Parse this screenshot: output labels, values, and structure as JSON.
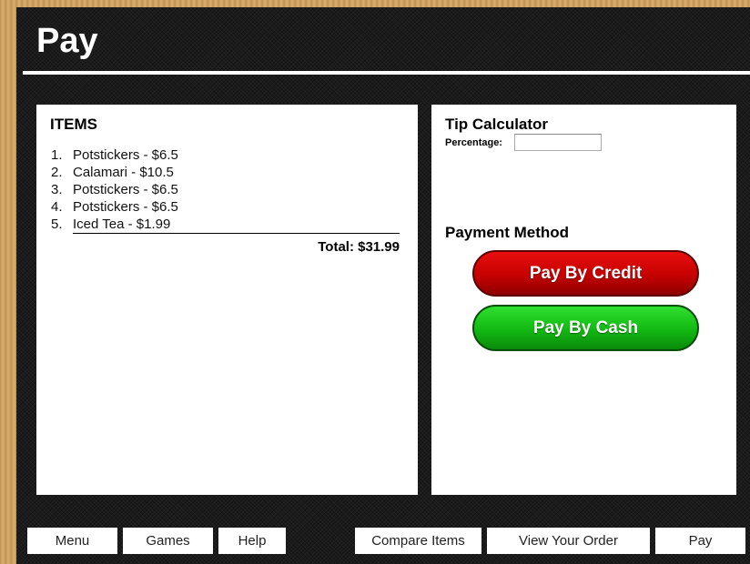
{
  "page": {
    "title": "Pay"
  },
  "items_panel": {
    "heading": "ITEMS",
    "items": [
      {
        "num": "1.",
        "text": "Potstickers - $6.5"
      },
      {
        "num": "2.",
        "text": "Calamari - $10.5"
      },
      {
        "num": "3.",
        "text": "Potstickers - $6.5"
      },
      {
        "num": "4.",
        "text": "Potstickers - $6.5"
      },
      {
        "num": "5.",
        "text": "Iced Tea - $1.99"
      }
    ],
    "total": "Total: $31.99"
  },
  "tip": {
    "heading": "Tip Calculator",
    "percentage_label": "Percentage:",
    "percentage_value": ""
  },
  "payment": {
    "heading": "Payment Method",
    "credit_label": "Pay By Credit",
    "cash_label": "Pay By Cash",
    "credit_color": "#c50000",
    "cash_color": "#12b812"
  },
  "nav": {
    "menu": "Menu",
    "games": "Games",
    "help": "Help",
    "compare": "Compare Items",
    "view_order": "View Your Order",
    "pay": "Pay"
  }
}
